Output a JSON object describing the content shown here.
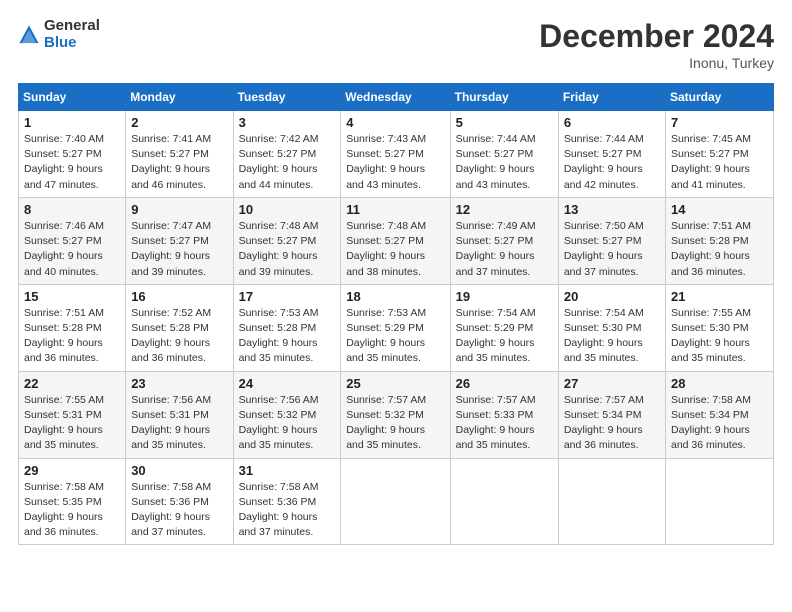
{
  "logo": {
    "general": "General",
    "blue": "Blue"
  },
  "title": "December 2024",
  "subtitle": "Inonu, Turkey",
  "headers": [
    "Sunday",
    "Monday",
    "Tuesday",
    "Wednesday",
    "Thursday",
    "Friday",
    "Saturday"
  ],
  "weeks": [
    [
      {
        "day": "1",
        "info": "Sunrise: 7:40 AM\nSunset: 5:27 PM\nDaylight: 9 hours\nand 47 minutes."
      },
      {
        "day": "2",
        "info": "Sunrise: 7:41 AM\nSunset: 5:27 PM\nDaylight: 9 hours\nand 46 minutes."
      },
      {
        "day": "3",
        "info": "Sunrise: 7:42 AM\nSunset: 5:27 PM\nDaylight: 9 hours\nand 44 minutes."
      },
      {
        "day": "4",
        "info": "Sunrise: 7:43 AM\nSunset: 5:27 PM\nDaylight: 9 hours\nand 43 minutes."
      },
      {
        "day": "5",
        "info": "Sunrise: 7:44 AM\nSunset: 5:27 PM\nDaylight: 9 hours\nand 43 minutes."
      },
      {
        "day": "6",
        "info": "Sunrise: 7:44 AM\nSunset: 5:27 PM\nDaylight: 9 hours\nand 42 minutes."
      },
      {
        "day": "7",
        "info": "Sunrise: 7:45 AM\nSunset: 5:27 PM\nDaylight: 9 hours\nand 41 minutes."
      }
    ],
    [
      {
        "day": "8",
        "info": "Sunrise: 7:46 AM\nSunset: 5:27 PM\nDaylight: 9 hours\nand 40 minutes."
      },
      {
        "day": "9",
        "info": "Sunrise: 7:47 AM\nSunset: 5:27 PM\nDaylight: 9 hours\nand 39 minutes."
      },
      {
        "day": "10",
        "info": "Sunrise: 7:48 AM\nSunset: 5:27 PM\nDaylight: 9 hours\nand 39 minutes."
      },
      {
        "day": "11",
        "info": "Sunrise: 7:48 AM\nSunset: 5:27 PM\nDaylight: 9 hours\nand 38 minutes."
      },
      {
        "day": "12",
        "info": "Sunrise: 7:49 AM\nSunset: 5:27 PM\nDaylight: 9 hours\nand 37 minutes."
      },
      {
        "day": "13",
        "info": "Sunrise: 7:50 AM\nSunset: 5:27 PM\nDaylight: 9 hours\nand 37 minutes."
      },
      {
        "day": "14",
        "info": "Sunrise: 7:51 AM\nSunset: 5:28 PM\nDaylight: 9 hours\nand 36 minutes."
      }
    ],
    [
      {
        "day": "15",
        "info": "Sunrise: 7:51 AM\nSunset: 5:28 PM\nDaylight: 9 hours\nand 36 minutes."
      },
      {
        "day": "16",
        "info": "Sunrise: 7:52 AM\nSunset: 5:28 PM\nDaylight: 9 hours\nand 36 minutes."
      },
      {
        "day": "17",
        "info": "Sunrise: 7:53 AM\nSunset: 5:28 PM\nDaylight: 9 hours\nand 35 minutes."
      },
      {
        "day": "18",
        "info": "Sunrise: 7:53 AM\nSunset: 5:29 PM\nDaylight: 9 hours\nand 35 minutes."
      },
      {
        "day": "19",
        "info": "Sunrise: 7:54 AM\nSunset: 5:29 PM\nDaylight: 9 hours\nand 35 minutes."
      },
      {
        "day": "20",
        "info": "Sunrise: 7:54 AM\nSunset: 5:30 PM\nDaylight: 9 hours\nand 35 minutes."
      },
      {
        "day": "21",
        "info": "Sunrise: 7:55 AM\nSunset: 5:30 PM\nDaylight: 9 hours\nand 35 minutes."
      }
    ],
    [
      {
        "day": "22",
        "info": "Sunrise: 7:55 AM\nSunset: 5:31 PM\nDaylight: 9 hours\nand 35 minutes."
      },
      {
        "day": "23",
        "info": "Sunrise: 7:56 AM\nSunset: 5:31 PM\nDaylight: 9 hours\nand 35 minutes."
      },
      {
        "day": "24",
        "info": "Sunrise: 7:56 AM\nSunset: 5:32 PM\nDaylight: 9 hours\nand 35 minutes."
      },
      {
        "day": "25",
        "info": "Sunrise: 7:57 AM\nSunset: 5:32 PM\nDaylight: 9 hours\nand 35 minutes."
      },
      {
        "day": "26",
        "info": "Sunrise: 7:57 AM\nSunset: 5:33 PM\nDaylight: 9 hours\nand 35 minutes."
      },
      {
        "day": "27",
        "info": "Sunrise: 7:57 AM\nSunset: 5:34 PM\nDaylight: 9 hours\nand 36 minutes."
      },
      {
        "day": "28",
        "info": "Sunrise: 7:58 AM\nSunset: 5:34 PM\nDaylight: 9 hours\nand 36 minutes."
      }
    ],
    [
      {
        "day": "29",
        "info": "Sunrise: 7:58 AM\nSunset: 5:35 PM\nDaylight: 9 hours\nand 36 minutes."
      },
      {
        "day": "30",
        "info": "Sunrise: 7:58 AM\nSunset: 5:36 PM\nDaylight: 9 hours\nand 37 minutes."
      },
      {
        "day": "31",
        "info": "Sunrise: 7:58 AM\nSunset: 5:36 PM\nDaylight: 9 hours\nand 37 minutes."
      },
      {
        "day": "",
        "info": ""
      },
      {
        "day": "",
        "info": ""
      },
      {
        "day": "",
        "info": ""
      },
      {
        "day": "",
        "info": ""
      }
    ]
  ]
}
